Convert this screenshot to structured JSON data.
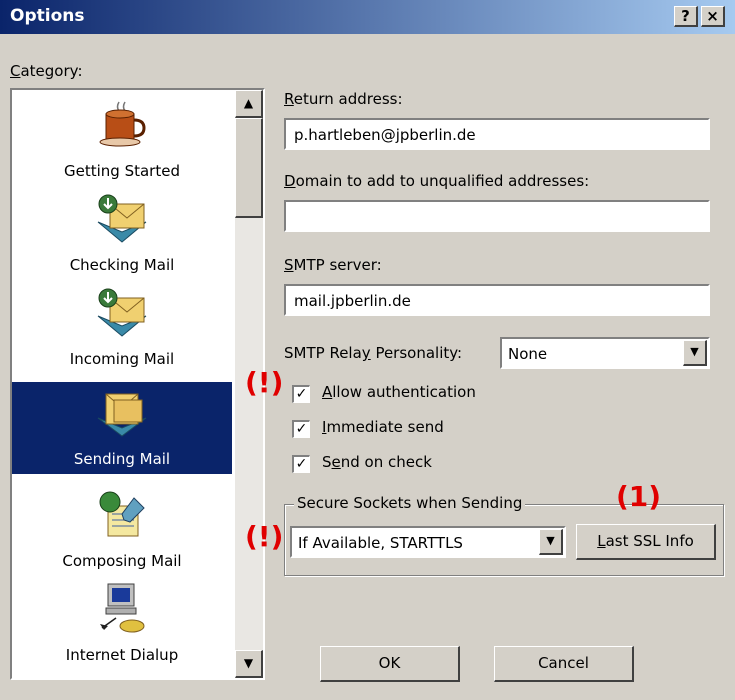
{
  "window": {
    "title": "Options",
    "help_btn": "?",
    "close_btn": "×"
  },
  "category": {
    "label": "Category:",
    "items": [
      {
        "label": "Getting Started",
        "icon": "coffee-cup-icon"
      },
      {
        "label": "Checking Mail",
        "icon": "mail-download-icon"
      },
      {
        "label": "Incoming Mail",
        "icon": "mail-download-icon"
      },
      {
        "label": "Sending Mail",
        "icon": "mail-send-icon",
        "selected": true
      },
      {
        "label": "Composing Mail",
        "icon": "compose-icon"
      },
      {
        "label": "Internet Dialup",
        "icon": "computer-phone-icon"
      }
    ]
  },
  "form": {
    "return_address_label": "Return address:",
    "return_address_value": "p.hartleben@jpberlin.de",
    "domain_label": "Domain to add to unqualified addresses:",
    "domain_value": "",
    "smtp_label": "SMTP server:",
    "smtp_value": "mail.jpberlin.de",
    "relay_label": "SMTP Relay Personality:",
    "relay_value": "None",
    "allow_auth_label": "Allow authentication",
    "immediate_send_label": "Immediate send",
    "send_on_check_label": "Send on check",
    "ssl_group_label": "Secure Sockets when Sending",
    "ssl_value": "If Available, STARTTLS",
    "last_ssl_label": "Last SSL Info"
  },
  "annotations": {
    "mark1": "(!)",
    "mark2": "(!)",
    "mark3": "(1)"
  },
  "buttons": {
    "ok": "OK",
    "cancel": "Cancel"
  },
  "colors": {
    "selection": "#0a246a",
    "annotation": "#e00000",
    "dialog_bg": "#d4d0c8"
  }
}
